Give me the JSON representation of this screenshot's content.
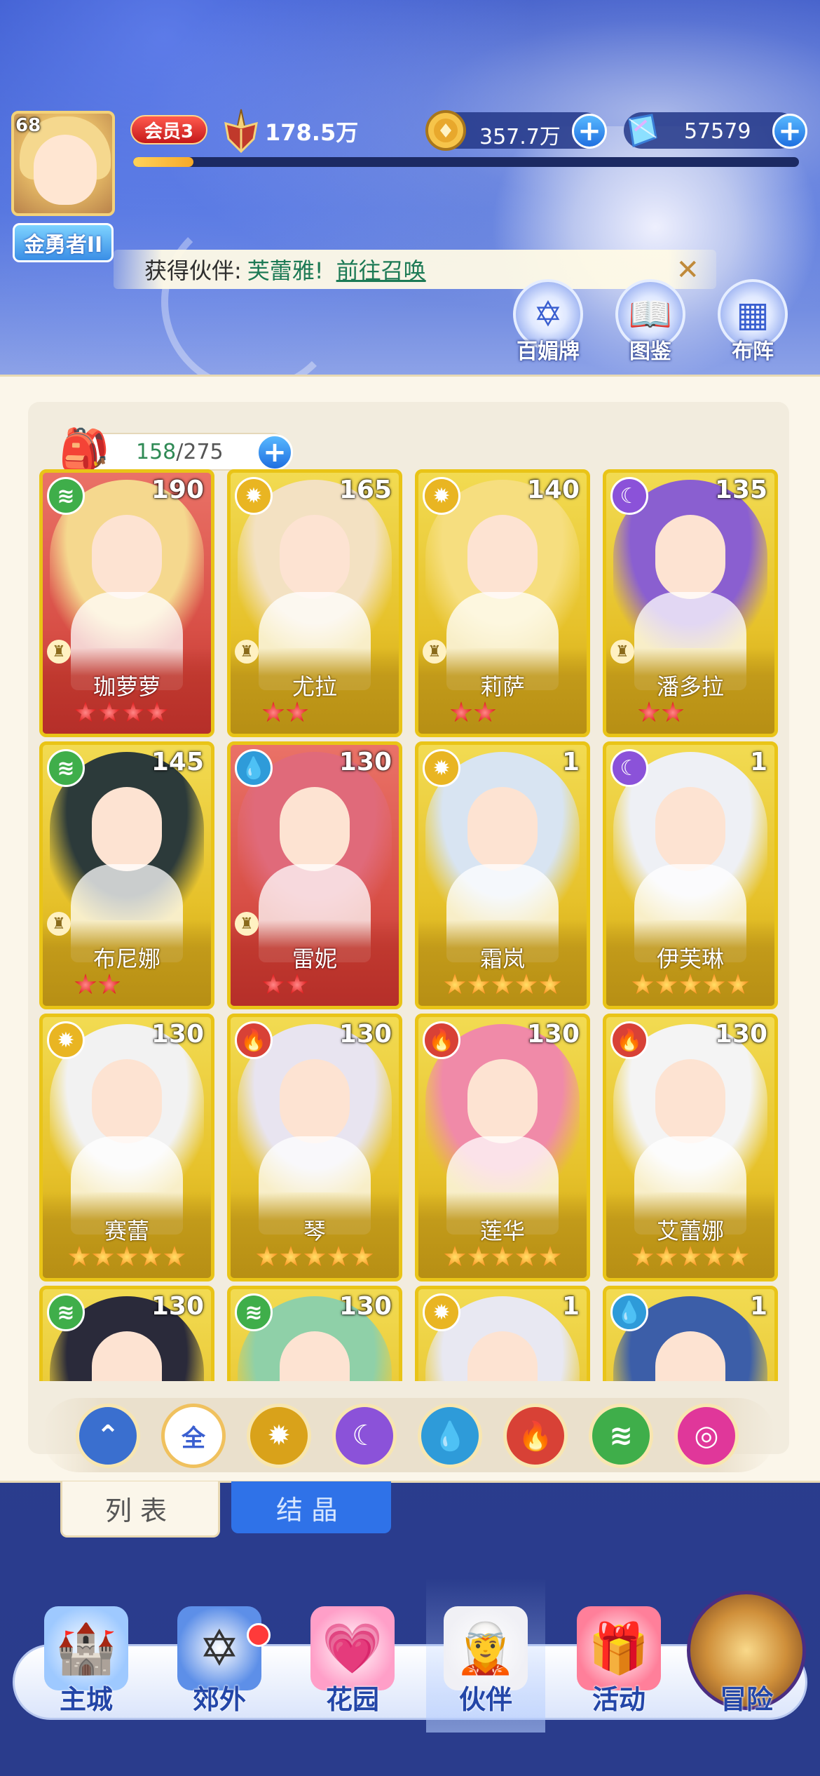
{
  "player": {
    "level": "68",
    "rank": "金勇者II",
    "vip": "会员3",
    "power": "178.5万",
    "power_progress": 0.09
  },
  "currency": {
    "gold": "357.7万",
    "gems": "57579"
  },
  "notice": {
    "prefix": "获得伙伴:",
    "name": "芙蕾雅!",
    "action": "前往召唤"
  },
  "top_actions": [
    {
      "label": "百媚牌",
      "icon": "hexagram-icon"
    },
    {
      "label": "图鉴",
      "icon": "book-icon"
    },
    {
      "label": "布阵",
      "icon": "grid-icon"
    }
  ],
  "capacity": {
    "current": "158",
    "max": "/275"
  },
  "elements": {
    "wind": "#3fae4a",
    "light": "#e9b522",
    "moon": "#8b52d9",
    "water": "#2e9bd9",
    "fire": "#d84136",
    "pink": "#e0379a"
  },
  "cards": [
    {
      "name": "珈萝萝",
      "level": "190",
      "element": "wind",
      "frame": "red",
      "stars": 4,
      "star_type": "red",
      "tower": true
    },
    {
      "name": "尤拉",
      "level": "165",
      "element": "light",
      "frame": "gold",
      "stars": 2,
      "star_type": "red",
      "tower": true
    },
    {
      "name": "莉萨",
      "level": "140",
      "element": "light",
      "frame": "gold",
      "stars": 2,
      "star_type": "red",
      "tower": true
    },
    {
      "name": "潘多拉",
      "level": "135",
      "element": "moon",
      "frame": "gold",
      "stars": 2,
      "star_type": "red",
      "tower": true
    },
    {
      "name": "布尼娜",
      "level": "145",
      "element": "wind",
      "frame": "gold",
      "stars": 2,
      "star_type": "red",
      "tower": true
    },
    {
      "name": "雷妮",
      "level": "130",
      "element": "water",
      "frame": "red",
      "stars": 2,
      "star_type": "red",
      "tower": true
    },
    {
      "name": "霜岚",
      "level": "1",
      "element": "light",
      "frame": "gold",
      "stars": 5,
      "star_type": "gold",
      "tower": false
    },
    {
      "name": "伊芙琳",
      "level": "1",
      "element": "moon",
      "frame": "gold",
      "stars": 5,
      "star_type": "gold",
      "tower": false
    },
    {
      "name": "赛蕾",
      "level": "130",
      "element": "light",
      "frame": "gold",
      "stars": 5,
      "star_type": "gold",
      "tower": false
    },
    {
      "name": "琴",
      "level": "130",
      "element": "fire",
      "frame": "gold",
      "stars": 5,
      "star_type": "gold",
      "tower": false
    },
    {
      "name": "莲华",
      "level": "130",
      "element": "fire",
      "frame": "gold",
      "stars": 5,
      "star_type": "gold",
      "tower": false
    },
    {
      "name": "艾蕾娜",
      "level": "130",
      "element": "fire",
      "frame": "gold",
      "stars": 5,
      "star_type": "gold",
      "tower": false
    },
    {
      "name": "",
      "level": "130",
      "element": "wind",
      "frame": "gold",
      "stars": 0,
      "star_type": "gold",
      "tower": false
    },
    {
      "name": "",
      "level": "130",
      "element": "wind",
      "frame": "gold",
      "stars": 0,
      "star_type": "gold",
      "tower": false
    },
    {
      "name": "",
      "level": "1",
      "element": "light",
      "frame": "gold",
      "stars": 0,
      "star_type": "gold",
      "tower": false
    },
    {
      "name": "",
      "level": "1",
      "element": "water",
      "frame": "gold",
      "stars": 0,
      "star_type": "gold",
      "tower": false
    }
  ],
  "filters": [
    {
      "id": "collapse",
      "label": "",
      "icon": "chevron-up-icon"
    },
    {
      "id": "all",
      "label": "全",
      "icon": "all-icon"
    },
    {
      "id": "light",
      "label": "",
      "icon": "sun-icon"
    },
    {
      "id": "moon",
      "label": "",
      "icon": "moon-icon"
    },
    {
      "id": "water",
      "label": "",
      "icon": "water-icon"
    },
    {
      "id": "fire",
      "label": "",
      "icon": "fire-icon"
    },
    {
      "id": "wind",
      "label": "",
      "icon": "wind-icon"
    },
    {
      "id": "pink",
      "label": "",
      "icon": "orbit-icon"
    }
  ],
  "tabs": {
    "list": "列表",
    "crystal": "结晶"
  },
  "nav": [
    {
      "label": "主城",
      "icon": "castle-icon"
    },
    {
      "label": "郊外",
      "icon": "portal-icon"
    },
    {
      "label": "花园",
      "icon": "heart-icon"
    },
    {
      "label": "伙伴",
      "icon": "partner-icon"
    },
    {
      "label": "活动",
      "icon": "gift-icon"
    },
    {
      "label": "冒险",
      "icon": "compass-icon"
    }
  ]
}
